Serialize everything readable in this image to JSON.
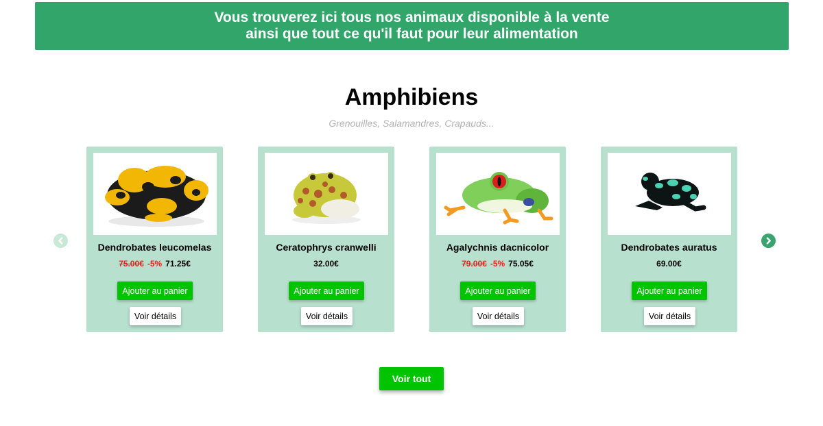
{
  "banner": {
    "line1": "Vous trouverez ici tous nos animaux disponible à la vente",
    "line2": "ainsi que tout ce qu'il faut pour leur alimentation"
  },
  "section": {
    "title": "Amphibiens",
    "subtitle": "Grenouilles, Salamandres, Crapauds..."
  },
  "products": [
    {
      "name": "Dendrobates leucomelas",
      "old_price": "75.00€",
      "discount": "-5%",
      "price": "71.25€",
      "image": "yellow-black-frog-photo"
    },
    {
      "name": "Ceratophrys cranwelli",
      "old_price": "",
      "discount": "",
      "price": "32.00€",
      "image": "horned-frog-photo"
    },
    {
      "name": "Agalychnis dacnicolor",
      "old_price": "79.00€",
      "discount": "-5%",
      "price": "75.05€",
      "image": "tree-frog-photo"
    },
    {
      "name": "Dendrobates auratus",
      "old_price": "",
      "discount": "",
      "price": "69.00€",
      "image": "green-black-dart-frog-photo"
    }
  ],
  "buttons": {
    "add_to_cart": "Ajouter au panier",
    "view_details": "Voir détails",
    "view_all": "Voir tout"
  },
  "carousel": {
    "prev_icon": "chevron-left-icon",
    "next_icon": "chevron-right-icon"
  },
  "colors": {
    "banner": "#32a56b",
    "card_bg": "#b8e0cf",
    "button_green": "#00c400",
    "discount_red": "#ff1a1a"
  }
}
